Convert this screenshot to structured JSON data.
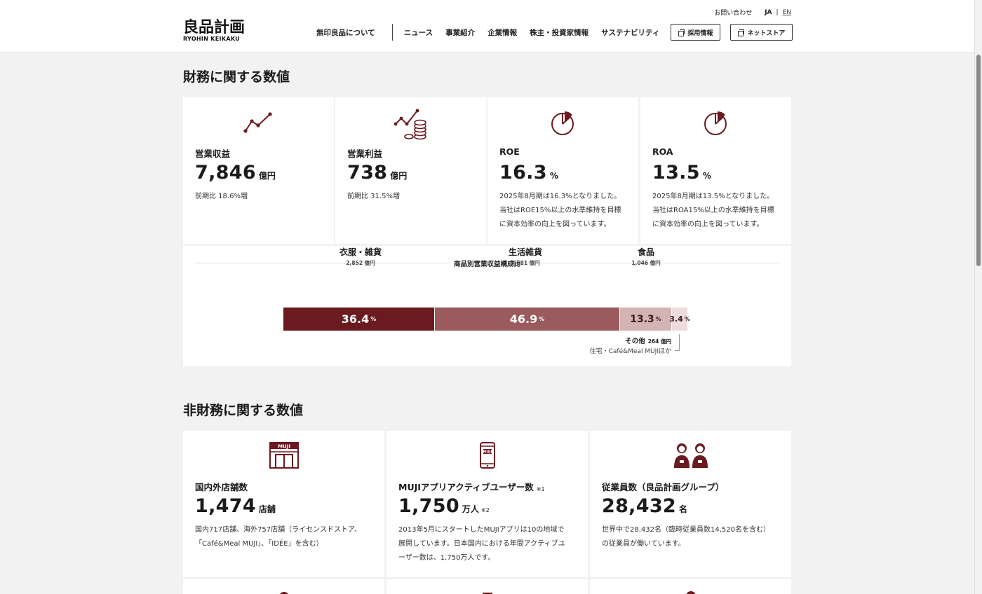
{
  "header": {
    "logo_jp": "良品計画",
    "logo_en": "RYOHIN KEIKAKU",
    "contact": "お問い合わせ",
    "lang_ja": "JA",
    "lang_sep": "|",
    "lang_en": "EN",
    "nav": [
      "無印良品について",
      "ニュース",
      "事業紹介",
      "企業情報",
      "株主・投資家情報",
      "サステナビリティ"
    ],
    "btn_recruit": "採用情報",
    "btn_store": "ネットストア"
  },
  "financial": {
    "title": "財務に関する数値",
    "cards": [
      {
        "label": "営業収益",
        "value": "7,846",
        "unit": "億円",
        "desc": [
          "前期比 18.6%増"
        ],
        "icon": "line-chart-icon"
      },
      {
        "label": "営業利益",
        "value": "738",
        "unit": "億円",
        "desc": [
          "前期比 31.5%増"
        ],
        "icon": "chart-coins-icon"
      },
      {
        "label": "ROE",
        "value": "16.3",
        "unit": "%",
        "desc": [
          "2025年8月期は16.3%となりました。",
          "当社はROE15%以上の水準維持を目標",
          "に資本効率の向上を図っています。"
        ],
        "icon": "pie-chart-icon"
      },
      {
        "label": "ROA",
        "value": "13.5",
        "unit": "%",
        "desc": [
          "2025年8月期は13.5%となりました。",
          "当社はROA15%以上の水準維持を目標",
          "に資本効率の向上を図っています。"
        ],
        "icon": "pie-chart-icon"
      }
    ],
    "breakdown": {
      "title": "商品別営業収益構成比",
      "segments": [
        {
          "name": "衣服・雑貨",
          "amount": "2,852",
          "amount_unit": "億円",
          "pct": "36.4",
          "share": 36.4,
          "color": "#6b1a20"
        },
        {
          "name": "生活雑貨",
          "amount": "3,681",
          "amount_unit": "億円",
          "pct": "46.9",
          "share": 46.9,
          "color": "#9a5a5e"
        },
        {
          "name": "食品",
          "amount": "1,046",
          "amount_unit": "億円",
          "pct": "13.3",
          "share": 13.3,
          "color": "#d4b3b4"
        },
        {
          "name": "その他",
          "amount": "264",
          "amount_unit": "億円",
          "pct": "3.4",
          "share": 3.4,
          "color": "#ecdcdd"
        }
      ],
      "pct_unit": "%",
      "other_sub": "住宅・Café&Meal MUJIほか"
    }
  },
  "nonfinancial": {
    "title": "非財務に関する数値",
    "cards": [
      {
        "label": "国内外店舗数",
        "sup": "",
        "value": "1,474",
        "unit": "店舗",
        "note": "",
        "desc": [
          "国内717店舗、海外757店舗（ライセンスドストア、",
          "「Café&Meal MUJI」、「IDÉE」を含む）"
        ],
        "icon": "store-icon",
        "store_sign": "MUJI"
      },
      {
        "label": "MUJIアプリアクティブユーザー数",
        "sup": "※1",
        "value": "1,750",
        "unit": "万人",
        "note": "※2",
        "desc": [
          "2013年5月にスタートしたMUJIアプリは10の地域で",
          "展開しています。日本国内における年間アクティブユ",
          "ーザー数は、1,750万人です。"
        ],
        "icon": "smartphone-icon",
        "phone_sign": "MUJI"
      },
      {
        "label": "従業員数（良品計画グループ）",
        "sup": "",
        "value": "28,432",
        "unit": "名",
        "note": "",
        "desc": [
          "世界中で28,432名（臨時従業員数14,520名を含む）",
          "の従業員が働いています。"
        ],
        "icon": "employees-icon"
      }
    ]
  }
}
